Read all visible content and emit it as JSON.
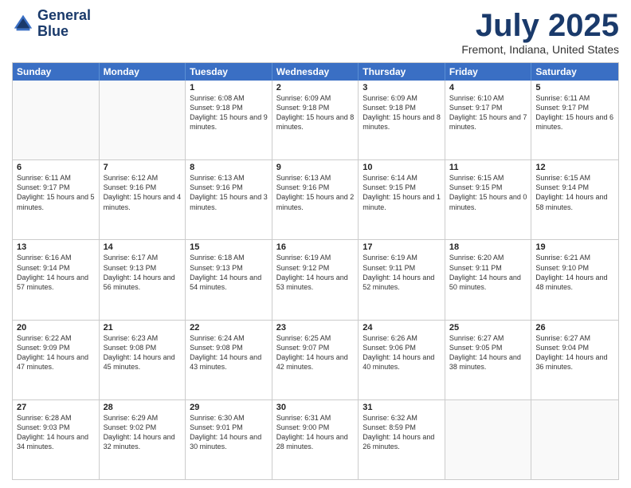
{
  "header": {
    "logo_line1": "General",
    "logo_line2": "Blue",
    "month_title": "July 2025",
    "location": "Fremont, Indiana, United States"
  },
  "days_of_week": [
    "Sunday",
    "Monday",
    "Tuesday",
    "Wednesday",
    "Thursday",
    "Friday",
    "Saturday"
  ],
  "weeks": [
    [
      {
        "day": "",
        "info": ""
      },
      {
        "day": "",
        "info": ""
      },
      {
        "day": "1",
        "info": "Sunrise: 6:08 AM\nSunset: 9:18 PM\nDaylight: 15 hours and 9 minutes."
      },
      {
        "day": "2",
        "info": "Sunrise: 6:09 AM\nSunset: 9:18 PM\nDaylight: 15 hours and 8 minutes."
      },
      {
        "day": "3",
        "info": "Sunrise: 6:09 AM\nSunset: 9:18 PM\nDaylight: 15 hours and 8 minutes."
      },
      {
        "day": "4",
        "info": "Sunrise: 6:10 AM\nSunset: 9:17 PM\nDaylight: 15 hours and 7 minutes."
      },
      {
        "day": "5",
        "info": "Sunrise: 6:11 AM\nSunset: 9:17 PM\nDaylight: 15 hours and 6 minutes."
      }
    ],
    [
      {
        "day": "6",
        "info": "Sunrise: 6:11 AM\nSunset: 9:17 PM\nDaylight: 15 hours and 5 minutes."
      },
      {
        "day": "7",
        "info": "Sunrise: 6:12 AM\nSunset: 9:16 PM\nDaylight: 15 hours and 4 minutes."
      },
      {
        "day": "8",
        "info": "Sunrise: 6:13 AM\nSunset: 9:16 PM\nDaylight: 15 hours and 3 minutes."
      },
      {
        "day": "9",
        "info": "Sunrise: 6:13 AM\nSunset: 9:16 PM\nDaylight: 15 hours and 2 minutes."
      },
      {
        "day": "10",
        "info": "Sunrise: 6:14 AM\nSunset: 9:15 PM\nDaylight: 15 hours and 1 minute."
      },
      {
        "day": "11",
        "info": "Sunrise: 6:15 AM\nSunset: 9:15 PM\nDaylight: 15 hours and 0 minutes."
      },
      {
        "day": "12",
        "info": "Sunrise: 6:15 AM\nSunset: 9:14 PM\nDaylight: 14 hours and 58 minutes."
      }
    ],
    [
      {
        "day": "13",
        "info": "Sunrise: 6:16 AM\nSunset: 9:14 PM\nDaylight: 14 hours and 57 minutes."
      },
      {
        "day": "14",
        "info": "Sunrise: 6:17 AM\nSunset: 9:13 PM\nDaylight: 14 hours and 56 minutes."
      },
      {
        "day": "15",
        "info": "Sunrise: 6:18 AM\nSunset: 9:13 PM\nDaylight: 14 hours and 54 minutes."
      },
      {
        "day": "16",
        "info": "Sunrise: 6:19 AM\nSunset: 9:12 PM\nDaylight: 14 hours and 53 minutes."
      },
      {
        "day": "17",
        "info": "Sunrise: 6:19 AM\nSunset: 9:11 PM\nDaylight: 14 hours and 52 minutes."
      },
      {
        "day": "18",
        "info": "Sunrise: 6:20 AM\nSunset: 9:11 PM\nDaylight: 14 hours and 50 minutes."
      },
      {
        "day": "19",
        "info": "Sunrise: 6:21 AM\nSunset: 9:10 PM\nDaylight: 14 hours and 48 minutes."
      }
    ],
    [
      {
        "day": "20",
        "info": "Sunrise: 6:22 AM\nSunset: 9:09 PM\nDaylight: 14 hours and 47 minutes."
      },
      {
        "day": "21",
        "info": "Sunrise: 6:23 AM\nSunset: 9:08 PM\nDaylight: 14 hours and 45 minutes."
      },
      {
        "day": "22",
        "info": "Sunrise: 6:24 AM\nSunset: 9:08 PM\nDaylight: 14 hours and 43 minutes."
      },
      {
        "day": "23",
        "info": "Sunrise: 6:25 AM\nSunset: 9:07 PM\nDaylight: 14 hours and 42 minutes."
      },
      {
        "day": "24",
        "info": "Sunrise: 6:26 AM\nSunset: 9:06 PM\nDaylight: 14 hours and 40 minutes."
      },
      {
        "day": "25",
        "info": "Sunrise: 6:27 AM\nSunset: 9:05 PM\nDaylight: 14 hours and 38 minutes."
      },
      {
        "day": "26",
        "info": "Sunrise: 6:27 AM\nSunset: 9:04 PM\nDaylight: 14 hours and 36 minutes."
      }
    ],
    [
      {
        "day": "27",
        "info": "Sunrise: 6:28 AM\nSunset: 9:03 PM\nDaylight: 14 hours and 34 minutes."
      },
      {
        "day": "28",
        "info": "Sunrise: 6:29 AM\nSunset: 9:02 PM\nDaylight: 14 hours and 32 minutes."
      },
      {
        "day": "29",
        "info": "Sunrise: 6:30 AM\nSunset: 9:01 PM\nDaylight: 14 hours and 30 minutes."
      },
      {
        "day": "30",
        "info": "Sunrise: 6:31 AM\nSunset: 9:00 PM\nDaylight: 14 hours and 28 minutes."
      },
      {
        "day": "31",
        "info": "Sunrise: 6:32 AM\nSunset: 8:59 PM\nDaylight: 14 hours and 26 minutes."
      },
      {
        "day": "",
        "info": ""
      },
      {
        "day": "",
        "info": ""
      }
    ]
  ]
}
